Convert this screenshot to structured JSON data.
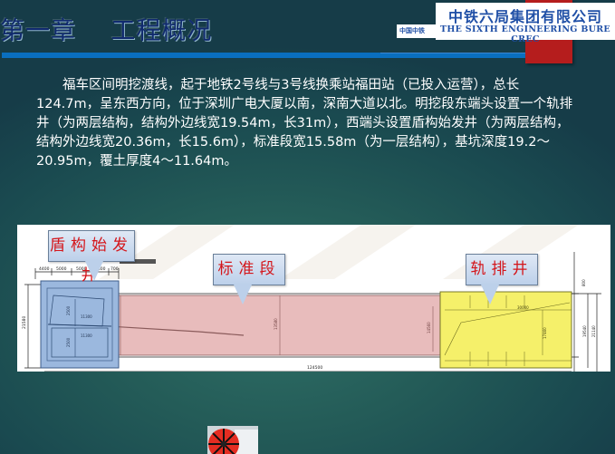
{
  "header": {
    "title": "第一章    工程概况",
    "logo_cn": "中铁六局集团有限公司",
    "logo_en": "THE SIXTH ENGINEERING BURE CREC",
    "logo_small": "中国中铁"
  },
  "body": {
    "paragraph": "福车区间明挖渡线，起于地铁2号线与3号线换乘站福田站（已投入运营），总长124.7m，呈东西方向，位于深圳广电大厦以南，深南大道以北。明挖段东端头设置一个轨排井（为两层结构，结构外边线宽19.54m，长31m），西端头设置盾构始发井（为两层结构，结构外边线宽20.36m，长15.6m），标准段宽15.58m（为一层结构），基坑深度19.2～20.95m，覆土厚度4～11.64m。"
  },
  "diagram": {
    "callouts": {
      "shield_launch_shaft": "盾构始发井",
      "standard_section": "标准段",
      "track_laying_shaft": "轨排井"
    },
    "dimensions": {
      "top_1": "4400",
      "top_2": "5000",
      "top_3": "5000",
      "top_4": "1800",
      "top_5": "700",
      "left_height": "21580",
      "inner_1": "2500",
      "inner_2": "11300",
      "inner_3": "11300",
      "inner_4": "2500",
      "std_1": "15960",
      "std_2": "13580",
      "std_3": "14560",
      "track_1": "30000",
      "track_2": "17460",
      "right_1": "19540",
      "right_2": "21140",
      "right_top": "800",
      "total_length": "124500"
    },
    "colors": {
      "shield_shaft": "#8fb0d8",
      "standard": "#e8bcbc",
      "track_shaft": "#f5f06a"
    }
  }
}
